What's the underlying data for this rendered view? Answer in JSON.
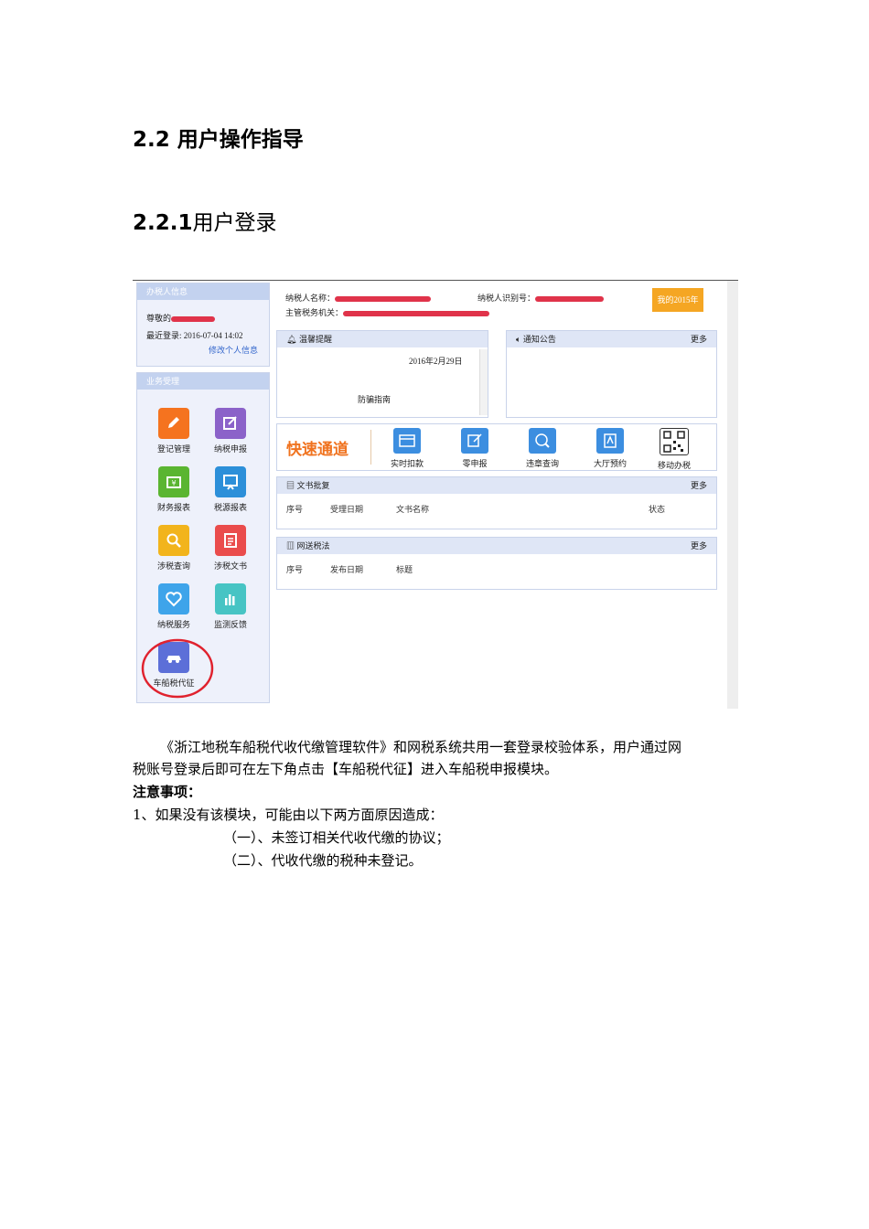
{
  "headings": {
    "h2_num": "2.2",
    "h2_text": "用户操作指导",
    "h3_num": "2.2.1",
    "h3_text": "用户登录"
  },
  "screenshot": {
    "left_panel": {
      "title": "办税人信息",
      "greeting": "尊敬的",
      "last_login": "最近登录: 2016-07-04 14:02",
      "edit_link": "修改个人信息"
    },
    "business": {
      "title": "业务受理",
      "tiles": [
        {
          "label": "登记管理",
          "icon": "pencil-icon",
          "color": "#f5731f"
        },
        {
          "label": "纳税申报",
          "icon": "edit-icon",
          "color": "#8b62c9"
        },
        {
          "label": "财务报表",
          "icon": "money-icon",
          "color": "#5ab531"
        },
        {
          "label": "税源报表",
          "icon": "board-icon",
          "color": "#2c8fd9"
        },
        {
          "label": "涉税查询",
          "icon": "search-icon",
          "color": "#f2b41c"
        },
        {
          "label": "涉税文书",
          "icon": "document-icon",
          "color": "#ea4c4c"
        },
        {
          "label": "纳税服务",
          "icon": "heart-icon",
          "color": "#3ea4ea"
        },
        {
          "label": "监测反馈",
          "icon": "chart-icon",
          "color": "#47c4c4"
        },
        {
          "label": "车船税代征",
          "icon": "car-icon",
          "color": "#5c6fd8"
        }
      ]
    },
    "taxpayer": {
      "name_label": "纳税人名称：",
      "id_label": "纳税人识别号：",
      "authority_label": "主管税务机关：",
      "year_button": "我的2015年"
    },
    "reminder": {
      "title": "温馨提醒",
      "date": "2016年2月29日",
      "guide": "防骗指南"
    },
    "notice": {
      "title": "通知公告",
      "more": "更多"
    },
    "quick": {
      "title": "快速通道",
      "items": [
        {
          "label": "实时扣款",
          "icon": "card-icon"
        },
        {
          "label": "零申报",
          "icon": "edit-icon"
        },
        {
          "label": "违章查询",
          "icon": "violation-icon"
        },
        {
          "label": "大厅预约",
          "icon": "booking-icon"
        },
        {
          "label": "移动办税",
          "icon": "qrcode-icon"
        }
      ]
    },
    "docs": {
      "title": "文书批复",
      "more": "更多",
      "cols": [
        "序号",
        "受理日期",
        "文书名称",
        "状态"
      ]
    },
    "law": {
      "title": "网送税法",
      "more": "更多",
      "cols": [
        "序号",
        "发布日期",
        "标题"
      ]
    }
  },
  "paragraph": {
    "line1": "《浙江地税车船税代收代缴管理软件》和网税系统共用一套登录校验体系，用户通过网",
    "line2": "税账号登录后即可在左下角点击【车船税代征】进入车船税申报模块。",
    "notes_title": "注意事项：",
    "note1": "1、如果没有该模块，可能由以下两方面原因造成：",
    "note1a": "（一）、未签订相关代收代缴的协议；",
    "note1b": "（二）、代收代缴的税种未登记。"
  }
}
